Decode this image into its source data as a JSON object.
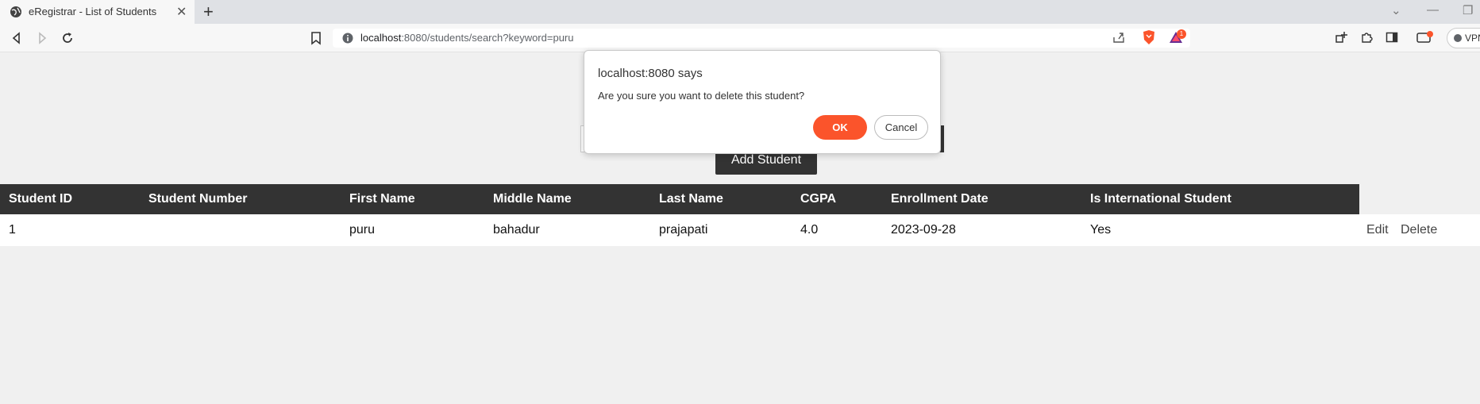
{
  "browser": {
    "tab_title": "eRegistrar - List of Students",
    "url_host": "localhost",
    "url_rest": ":8080/students/search?keyword=puru",
    "vpn_label": "VPN",
    "alert_badge": "1"
  },
  "page": {
    "add_button_label": "Add Student"
  },
  "table": {
    "columns": [
      "Student ID",
      "Student Number",
      "First Name",
      "Middle Name",
      "Last Name",
      "CGPA",
      "Enrollment Date",
      "Is International Student"
    ],
    "rows": [
      {
        "student_id": "1",
        "student_number": "",
        "first_name": "puru",
        "middle_name": "bahadur",
        "last_name": "prajapati",
        "cgpa": "4.0",
        "enrollment_date": "2023-09-28",
        "is_international": "Yes",
        "edit_label": "Edit",
        "delete_label": "Delete"
      }
    ]
  },
  "dialog": {
    "title": "localhost:8080 says",
    "message": "Are you sure you want to delete this student?",
    "ok_label": "OK",
    "cancel_label": "Cancel"
  },
  "colors": {
    "accent": "#fb542b",
    "header_bg": "#333333"
  }
}
